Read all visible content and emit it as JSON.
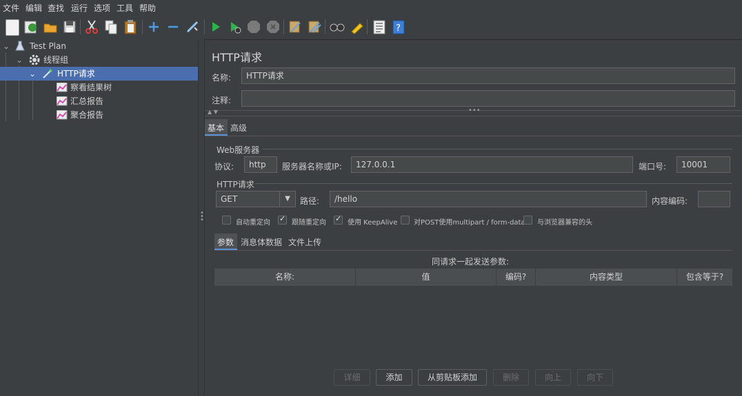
{
  "menu": [
    "文件",
    "编辑",
    "查找",
    "运行",
    "选项",
    "工具",
    "帮助"
  ],
  "toolbar_icons": [
    "new-icon",
    "templates-icon",
    "open-icon",
    "save-icon",
    "cut-icon",
    "copy-icon",
    "paste-icon",
    "add-icon",
    "remove-icon",
    "toggle-icon",
    "start-icon",
    "start-no-pause-icon",
    "stop-icon",
    "shutdown-icon",
    "clear-icon",
    "clear-all-icon",
    "search-icon",
    "reset-search-icon",
    "function-helper-icon",
    "help-icon"
  ],
  "tree": {
    "test_plan": "Test Plan",
    "thread_group": "线程组",
    "http_request": "HTTP请求",
    "view_results_tree": "察看结果树",
    "summary_report": "汇总报告",
    "aggregate_report": "聚合报告"
  },
  "panel": {
    "title": "HTTP请求",
    "name_label": "名称:",
    "name_value": "HTTP请求",
    "comment_label": "注释:",
    "comment_value": "",
    "tabs": [
      "基本",
      "高级"
    ],
    "web_server_legend": "Web服务器",
    "protocol_label": "协议:",
    "protocol_value": "http",
    "server_label": "服务器名称或IP:",
    "server_value": "127.0.0.1",
    "port_label": "端口号:",
    "port_value": "10001",
    "http_request_legend": "HTTP请求",
    "method_value": "GET",
    "path_label": "路径:",
    "path_value": "/hello",
    "encoding_label": "内容编码:",
    "encoding_value": "",
    "checkboxes": [
      {
        "label": "自动重定向",
        "checked": false
      },
      {
        "label": "跟随重定向",
        "checked": true
      },
      {
        "label": "使用 KeepAlive",
        "checked": true
      },
      {
        "label": "对POST使用multipart / form-data",
        "checked": false
      },
      {
        "label": "与浏览器兼容的头",
        "checked": false
      }
    ],
    "sub_tabs": [
      "参数",
      "消息体数据",
      "文件上传"
    ],
    "params_caption": "同请求一起发送参数:",
    "columns": [
      "名称:",
      "值",
      "编码?",
      "内容类型",
      "包含等于?"
    ],
    "buttons": {
      "detail": "详细",
      "add": "添加",
      "add_clipboard": "从剪贴板添加",
      "delete": "删除",
      "up": "向上",
      "down": "向下"
    }
  }
}
